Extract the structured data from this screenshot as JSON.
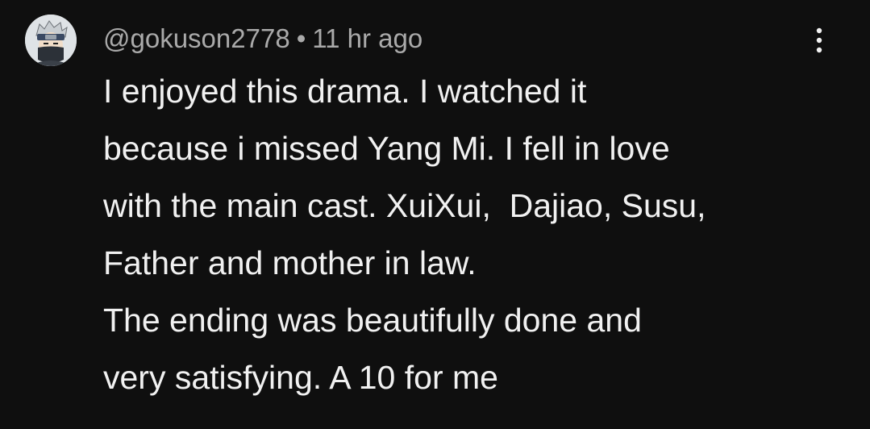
{
  "comment": {
    "author": "@gokuson2778",
    "separator": "•",
    "timestamp": "11 hr ago",
    "lines": [
      "I enjoyed this drama. I watched it",
      "because i missed Yang Mi. I fell in love",
      "with the main cast. XuiXui,  Dajiao, Susu,",
      "Father and mother in law.",
      "The ending was beautifully done and",
      "very satisfying. A 10 for me"
    ]
  },
  "icons": {
    "avatar": "ninja-avatar-icon",
    "menu": "more-vert-icon"
  },
  "colors": {
    "background": "#0f0f0f",
    "text": "#f1f1f1",
    "meta": "#aaaaaa"
  }
}
